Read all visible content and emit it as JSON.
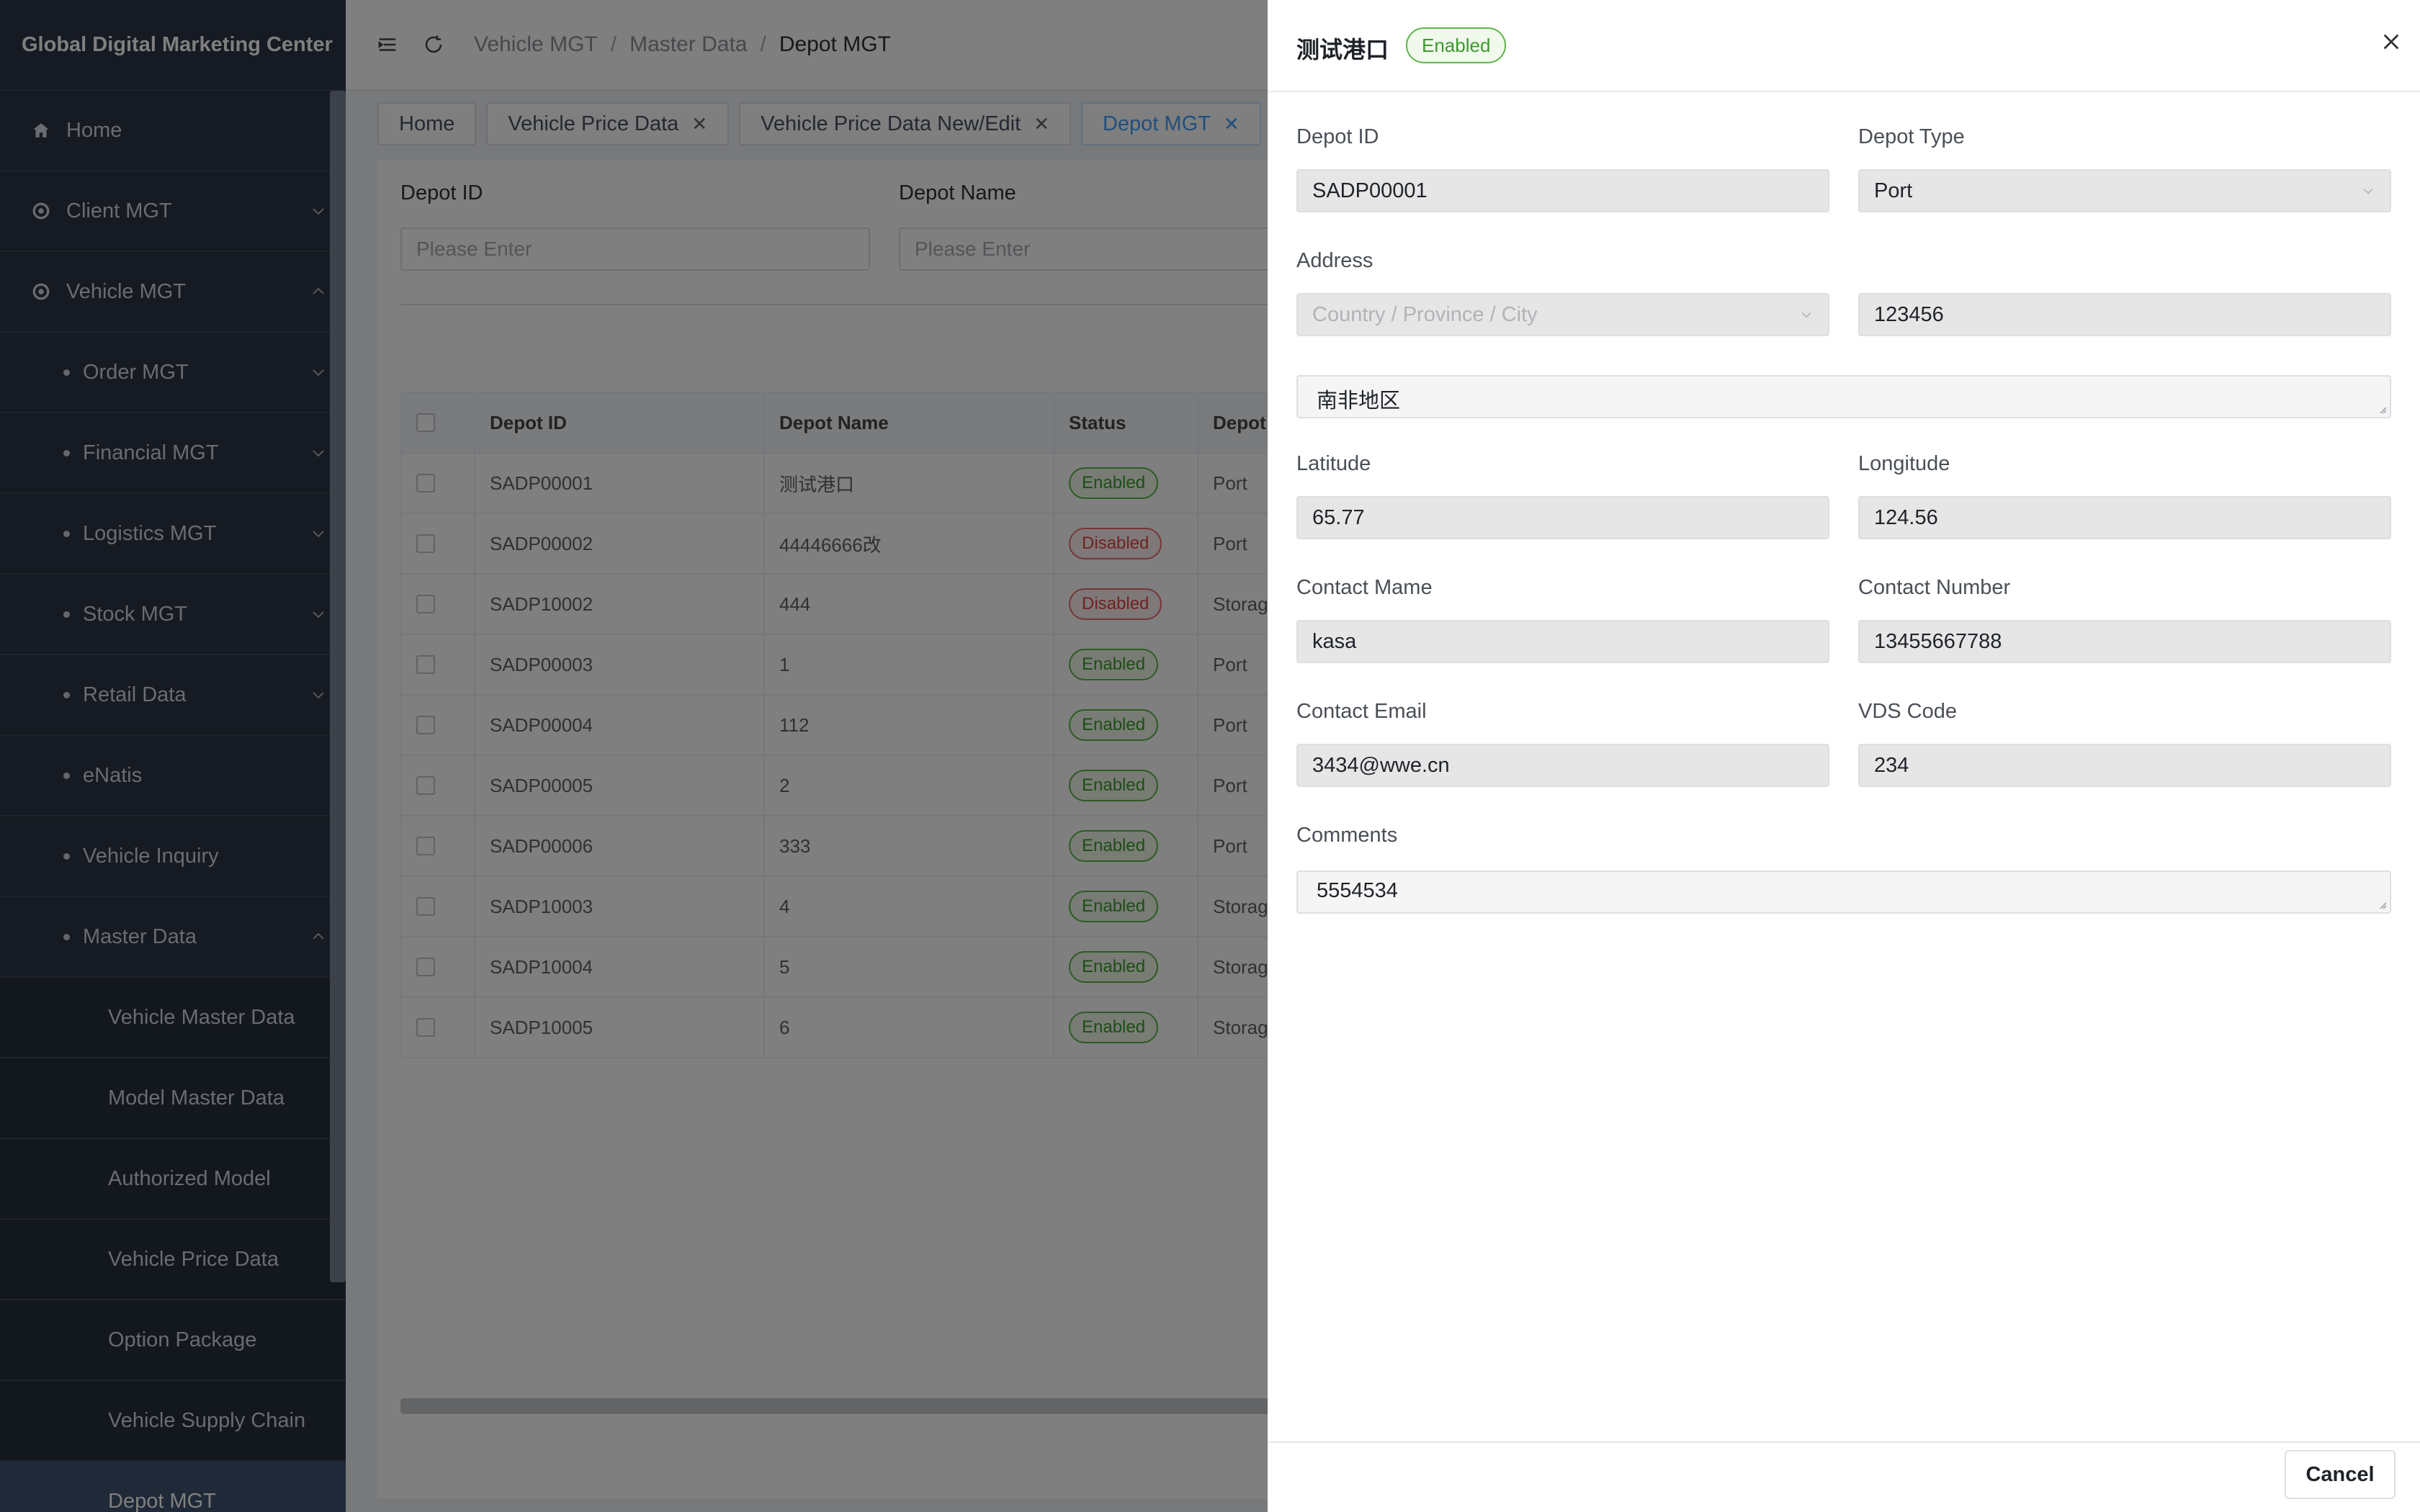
{
  "app": {
    "title": "Global Digital Marketing Center"
  },
  "sidebar": {
    "home": "Home",
    "client_mgt": "Client MGT",
    "vehicle_mgt": "Vehicle MGT",
    "order_mgt": "Order MGT",
    "financial_mgt": "Financial MGT",
    "logistics_mgt": "Logistics MGT",
    "stock_mgt": "Stock MGT",
    "retail_data": "Retail Data",
    "enatis": "eNatis",
    "vehicle_inquiry": "Vehicle Inquiry",
    "master_data": "Master Data",
    "vehicle_master_data": "Vehicle Master Data",
    "model_master_data": "Model Master Data",
    "authorized_model": "Authorized Model",
    "vehicle_price_data": "Vehicle Price Data",
    "option_package": "Option Package",
    "vehicle_supply_chain": "Vehicle Supply Chain",
    "depot_mgt": "Depot MGT"
  },
  "breadcrumb": {
    "level1": "Vehicle MGT",
    "level2": "Master Data",
    "current": "Depot MGT",
    "separator": "/"
  },
  "tabs": {
    "home": "Home",
    "vehicle_price_data": "Vehicle Price Data",
    "vehicle_price_edit": "Vehicle Price Data New/Edit",
    "depot_mgt": "Depot MGT",
    "close": "✕"
  },
  "filters": {
    "depot_id_label": "Depot ID",
    "depot_id_placeholder": "Please Enter",
    "depot_name_label": "Depot Name",
    "depot_name_placeholder": "Please Enter"
  },
  "table": {
    "headers": {
      "depot_id": "Depot ID",
      "depot_name": "Depot Name",
      "status": "Status",
      "depot_type": "Depot"
    },
    "rows": [
      {
        "id": "SADP00001",
        "name": "测试港口",
        "status": "Enabled",
        "type": "Port"
      },
      {
        "id": "SADP00002",
        "name": "44446666改",
        "status": "Disabled",
        "type": "Port"
      },
      {
        "id": "SADP10002",
        "name": "444",
        "status": "Disabled",
        "type": "Storag"
      },
      {
        "id": "SADP00003",
        "name": "1",
        "status": "Enabled",
        "type": "Port"
      },
      {
        "id": "SADP00004",
        "name": "112",
        "status": "Enabled",
        "type": "Port"
      },
      {
        "id": "SADP00005",
        "name": "2",
        "status": "Enabled",
        "type": "Port"
      },
      {
        "id": "SADP00006",
        "name": "333",
        "status": "Enabled",
        "type": "Port"
      },
      {
        "id": "SADP10003",
        "name": "4",
        "status": "Enabled",
        "type": "Storag"
      },
      {
        "id": "SADP10004",
        "name": "5",
        "status": "Enabled",
        "type": "Storag"
      },
      {
        "id": "SADP10005",
        "name": "6",
        "status": "Enabled",
        "type": "Storag"
      }
    ]
  },
  "drawer": {
    "title": "测试港口",
    "badge": "Enabled",
    "labels": {
      "depot_id": "Depot ID",
      "depot_type": "Depot Type",
      "address": "Address",
      "latitude": "Latitude",
      "longitude": "Longitude",
      "contact_name": "Contact Mame",
      "contact_number": "Contact Number",
      "contact_email": "Contact Email",
      "vds_code": "VDS Code",
      "comments": "Comments"
    },
    "values": {
      "depot_id": "SADP00001",
      "depot_type": "Port",
      "region_placeholder": "Country / Province / City",
      "postal_code": "123456",
      "address_detail": "南非地区",
      "latitude": "65.77",
      "longitude": "124.56",
      "contact_name": "kasa",
      "contact_number": "13455667788",
      "contact_email": "3434@wwe.cn",
      "vds_code": "234",
      "comments": "5554534"
    },
    "cancel": "Cancel"
  },
  "colors": {
    "sidebar_bg": "#2c3545",
    "accent": "#409eff",
    "enabled": "#3d9a2d",
    "disabled": "#e04545"
  }
}
